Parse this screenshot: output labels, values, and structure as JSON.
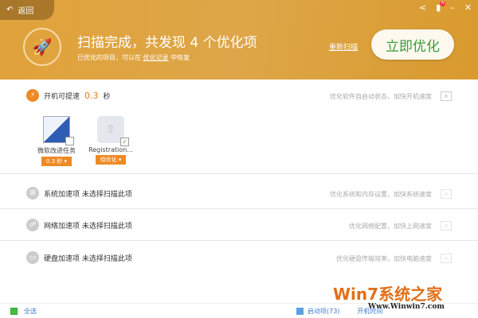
{
  "header": {
    "back_label": "返回",
    "title": "扫描完成，共发现 4 个优化项",
    "subtitle_prefix": "已优化的项目，可以在",
    "subtitle_link": "优化记录",
    "subtitle_suffix": "中恢复",
    "rescan": "重新扫描",
    "optimize_button": "立即优化",
    "notification_count": "N"
  },
  "sections": [
    {
      "label": "开机可提速",
      "value": "0.3",
      "unit": "秒",
      "hint": "优化软件自启动状态，加快开机速度",
      "items": [
        {
          "name": "微软改进任务",
          "tag": "0.3 秒 ▾"
        },
        {
          "name": "Registration...",
          "tag": "待优化 ▾"
        }
      ]
    },
    {
      "label": "系统加速项 未选择扫描此项",
      "hint": "优化系统和内存设置，加快系统速度"
    },
    {
      "label": "网络加速项 未选择扫描此项",
      "hint": "优化网络配置，加快上网速度"
    },
    {
      "label": "硬盘加速项 未选择扫描此项",
      "hint": "优化硬盘传输效率，加快电脑速度"
    }
  ],
  "footer": {
    "select_all": "全选",
    "startup": "启动项(73)",
    "boot_time": "开机时间"
  },
  "watermark": {
    "brand": "Win7系统之家",
    "url": "Www.Winwin7.com"
  }
}
